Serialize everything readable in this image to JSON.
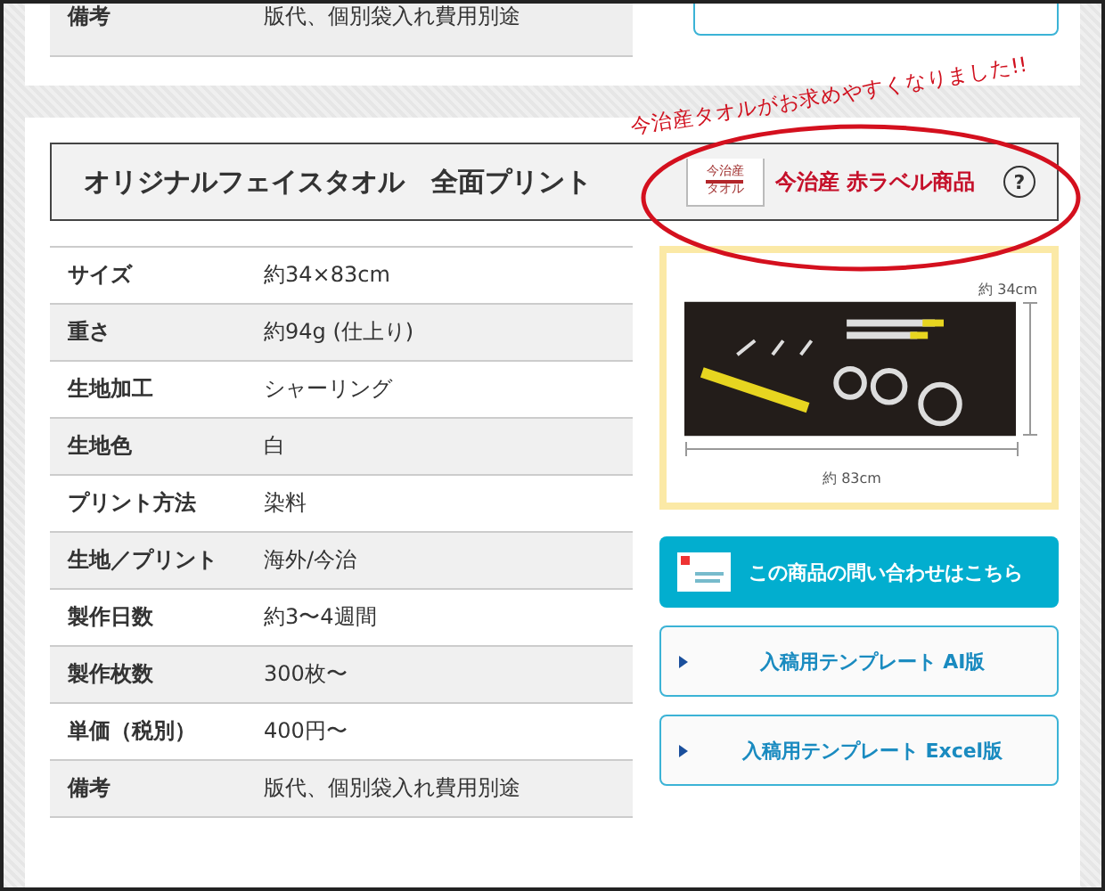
{
  "previous_item": {
    "spec_row": {
      "label": "備考",
      "value": "版代、個別袋入れ費用別途"
    }
  },
  "product": {
    "title": "オリジナルフェイスタオル　全面プリント",
    "badge": {
      "logo_top": "今治産",
      "logo_bottom": "タオル",
      "label": "今治産 赤ラベル商品",
      "help": "?"
    },
    "annotation": "今治産タオルがお求めやすくなりました!!",
    "specs": [
      {
        "label": "サイズ",
        "value": "約34×83cm"
      },
      {
        "label": "重さ",
        "value": "約94g (仕上り)"
      },
      {
        "label": "生地加工",
        "value": "シャーリング"
      },
      {
        "label": "生地色",
        "value": "白"
      },
      {
        "label": "プリント方法",
        "value": "染料"
      },
      {
        "label": "生地／プリント",
        "value": "海外/今治"
      },
      {
        "label": "製作日数",
        "value": "約3〜4週間"
      },
      {
        "label": "製作枚数",
        "value": "300枚〜"
      },
      {
        "label": "単価（税別）",
        "value": "400円〜"
      },
      {
        "label": "備考",
        "value": "版代、個別袋入れ費用別途"
      }
    ],
    "image": {
      "height_label": "約 34cm",
      "width_label": "約 83cm"
    },
    "buttons": [
      {
        "kind": "contact",
        "label": "この商品の問い合わせはこちら"
      },
      {
        "kind": "template",
        "label": "入稿用テンプレート AI版"
      },
      {
        "kind": "template",
        "label": "入稿用テンプレート Excel版"
      }
    ]
  }
}
